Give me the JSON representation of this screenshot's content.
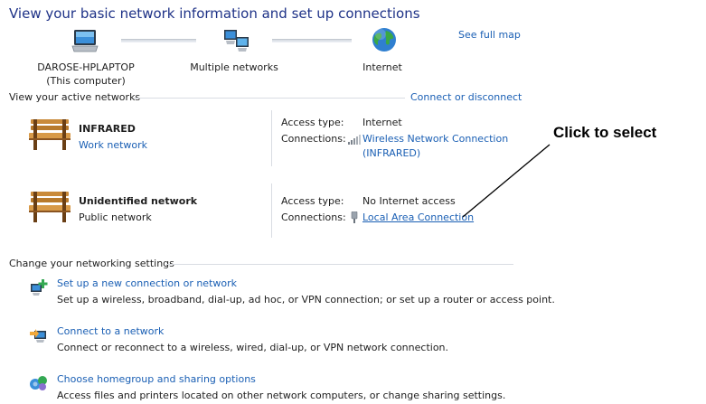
{
  "header": {
    "title": "View your basic network information and set up connections",
    "see_full_map": "See full map"
  },
  "map": {
    "computer": {
      "name": "DAROSE-HPLAPTOP",
      "sub": "(This computer)",
      "icon": "computer-icon"
    },
    "networks": {
      "name": "Multiple networks",
      "icon": "network-icon"
    },
    "internet": {
      "name": "Internet",
      "icon": "globe-icon"
    }
  },
  "active": {
    "heading": "View your active networks",
    "connect_link": "Connect or disconnect",
    "networks": [
      {
        "name": "INFRARED",
        "type": "Work network",
        "type_is_link": true,
        "access_label": "Access type:",
        "access_value": "Internet",
        "conn_label": "Connections:",
        "conn_line1": "Wireless Network Connection",
        "conn_line2": "(INFRARED)"
      },
      {
        "name": "Unidentified network",
        "type": "Public network",
        "type_is_link": false,
        "access_label": "Access type:",
        "access_value": "No Internet access",
        "conn_label": "Connections:",
        "conn_line1": "Local Area Connection"
      }
    ]
  },
  "settings": {
    "heading": "Change your networking settings",
    "tasks": [
      {
        "title": "Set up a new connection or network",
        "desc": "Set up a wireless, broadband, dial-up, ad hoc, or VPN connection; or set up a router or access point."
      },
      {
        "title": "Connect to a network",
        "desc": "Connect or reconnect to a wireless, wired, dial-up, or VPN network connection."
      },
      {
        "title": "Choose homegroup and sharing options",
        "desc": "Access files and printers located on other network computers, or change sharing settings."
      }
    ]
  },
  "annotation": {
    "text": "Click to select"
  },
  "colors": {
    "link": "#1a5fb4",
    "title": "#1e3287",
    "rule": "#d9dde3"
  }
}
